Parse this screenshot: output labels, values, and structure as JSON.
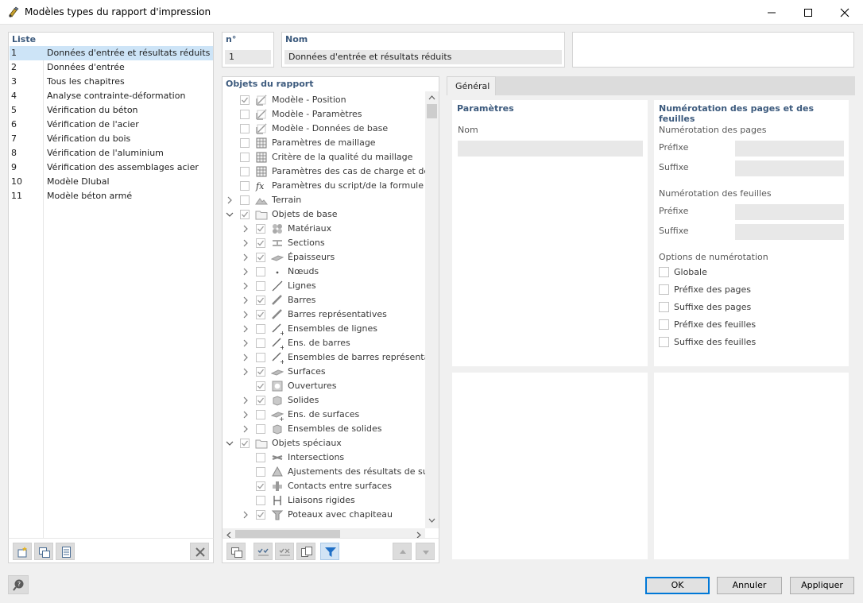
{
  "window": {
    "title": "Modèles types du rapport d'impression"
  },
  "list": {
    "header": "Liste",
    "items": [
      {
        "num": "1",
        "label": "Données d'entrée et résultats réduits"
      },
      {
        "num": "2",
        "label": "Données d'entrée"
      },
      {
        "num": "3",
        "label": "Tous les chapitres"
      },
      {
        "num": "4",
        "label": "Analyse contrainte-déformation"
      },
      {
        "num": "5",
        "label": "Vérification du béton"
      },
      {
        "num": "6",
        "label": "Vérification de l'acier"
      },
      {
        "num": "7",
        "label": "Vérification du bois"
      },
      {
        "num": "8",
        "label": "Vérification de l'aluminium"
      },
      {
        "num": "9",
        "label": "Vérification des assemblages acier"
      },
      {
        "num": "10",
        "label": "Modèle Dlubal"
      },
      {
        "num": "11",
        "label": "Modèle béton armé"
      }
    ],
    "selected_index": 0
  },
  "record": {
    "no_header": "n°",
    "no_value": "1",
    "name_header": "Nom",
    "name_value": "Données d'entrée et résultats réduits"
  },
  "tree": {
    "header": "Objets du rapport",
    "items": [
      {
        "label": "Modèle - Position",
        "level": 0,
        "expander": "",
        "checked": true,
        "icon": "model-position-icon"
      },
      {
        "label": "Modèle - Paramètres",
        "level": 0,
        "expander": "",
        "checked": false,
        "icon": "model-params-icon"
      },
      {
        "label": "Modèle - Données de base",
        "level": 0,
        "expander": "",
        "checked": false,
        "icon": "model-basic-data-icon"
      },
      {
        "label": "Paramètres de maillage",
        "level": 0,
        "expander": "",
        "checked": false,
        "icon": "mesh-settings-icon"
      },
      {
        "label": "Critère de la qualité du maillage",
        "level": 0,
        "expander": "",
        "checked": false,
        "icon": "mesh-quality-icon"
      },
      {
        "label": "Paramètres des cas de charge et des c",
        "level": 0,
        "expander": "",
        "checked": false,
        "icon": "load-case-settings-icon"
      },
      {
        "label": "Paramètres du script/de la formule",
        "level": 0,
        "expander": "",
        "checked": false,
        "icon": "formula-icon"
      },
      {
        "label": "Terrain",
        "level": 0,
        "expander": "collapsed",
        "checked": false,
        "icon": "terrain-icon"
      },
      {
        "label": "Objets de base",
        "level": 0,
        "expander": "expanded",
        "checked": true,
        "icon": "folder-icon"
      },
      {
        "label": "Matériaux",
        "level": 1,
        "expander": "collapsed",
        "checked": true,
        "icon": "materials-icon"
      },
      {
        "label": "Sections",
        "level": 1,
        "expander": "collapsed",
        "checked": true,
        "icon": "sections-icon"
      },
      {
        "label": "Épaisseurs",
        "level": 1,
        "expander": "collapsed",
        "checked": true,
        "icon": "thickness-icon"
      },
      {
        "label": "Nœuds",
        "level": 1,
        "expander": "collapsed",
        "checked": false,
        "icon": "node-icon"
      },
      {
        "label": "Lignes",
        "level": 1,
        "expander": "collapsed",
        "checked": false,
        "icon": "line-icon"
      },
      {
        "label": "Barres",
        "level": 1,
        "expander": "collapsed",
        "checked": true,
        "icon": "member-icon"
      },
      {
        "label": "Barres représentatives",
        "level": 1,
        "expander": "collapsed",
        "checked": true,
        "icon": "representative-member-icon"
      },
      {
        "label": "Ensembles de lignes",
        "level": 1,
        "expander": "collapsed",
        "checked": false,
        "icon": "line-set-icon"
      },
      {
        "label": "Ens. de barres",
        "level": 1,
        "expander": "collapsed",
        "checked": false,
        "icon": "member-set-icon"
      },
      {
        "label": "Ensembles de barres représentatif",
        "level": 1,
        "expander": "collapsed",
        "checked": false,
        "icon": "representative-member-set-icon"
      },
      {
        "label": "Surfaces",
        "level": 1,
        "expander": "collapsed",
        "checked": true,
        "icon": "surface-icon"
      },
      {
        "label": "Ouvertures",
        "level": 1,
        "expander": "",
        "checked": true,
        "icon": "opening-icon"
      },
      {
        "label": "Solides",
        "level": 1,
        "expander": "collapsed",
        "checked": true,
        "icon": "solid-icon"
      },
      {
        "label": "Ens. de surfaces",
        "level": 1,
        "expander": "collapsed",
        "checked": false,
        "icon": "surface-set-icon"
      },
      {
        "label": "Ensembles de solides",
        "level": 1,
        "expander": "collapsed",
        "checked": false,
        "icon": "solid-set-icon"
      },
      {
        "label": "Objets spéciaux",
        "level": 0,
        "expander": "expanded",
        "checked": true,
        "icon": "folder-icon"
      },
      {
        "label": "Intersections",
        "level": 1,
        "expander": "",
        "checked": false,
        "icon": "intersection-icon"
      },
      {
        "label": "Ajustements des résultats de surfa",
        "level": 1,
        "expander": "",
        "checked": false,
        "icon": "surface-results-adjustment-icon"
      },
      {
        "label": "Contacts entre surfaces",
        "level": 1,
        "expander": "",
        "checked": true,
        "icon": "surface-contact-icon"
      },
      {
        "label": "Liaisons rigides",
        "level": 1,
        "expander": "",
        "checked": false,
        "icon": "rigid-link-icon"
      },
      {
        "label": "Poteaux avec chapiteau",
        "level": 1,
        "expander": "collapsed",
        "checked": true,
        "icon": "column-capital-icon"
      }
    ]
  },
  "tabs": [
    {
      "label": "Général",
      "active": true
    }
  ],
  "params": {
    "header": "Paramètres",
    "name_label": "Nom",
    "name_value": ""
  },
  "numbering": {
    "header": "Numérotation des pages et des feuilles",
    "pages_label": "Numérotation des pages",
    "prefix_label": "Préfixe",
    "suffix_label": "Suffixe",
    "sheets_label": "Numérotation des feuilles",
    "sheets_prefix_label": "Préfixe",
    "sheets_suffix_label": "Suffixe",
    "options_label": "Options de numérotation",
    "options": [
      {
        "label": "Globale",
        "checked": false
      },
      {
        "label": "Préfixe des pages",
        "checked": false
      },
      {
        "label": "Suffixe des pages",
        "checked": false
      },
      {
        "label": "Préfixe des feuilles",
        "checked": false
      },
      {
        "label": "Suffixe des feuilles",
        "checked": false
      }
    ]
  },
  "footer": {
    "ok": "OK",
    "cancel": "Annuler",
    "apply": "Appliquer"
  },
  "colors": {
    "accent": "#0078d7",
    "header_text": "#3c5a7d",
    "selection": "#cde4f7"
  }
}
